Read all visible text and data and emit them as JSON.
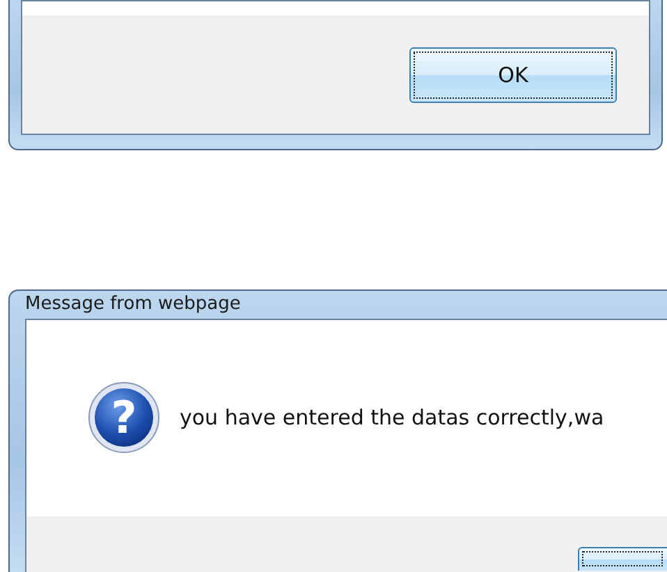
{
  "dialogs": [
    {
      "buttons": [
        {
          "label": "OK",
          "focused": true
        }
      ]
    },
    {
      "title": "Message from webpage",
      "message": "you have entered the datas correctly,wa",
      "icon_glyph": "?",
      "buttons": [
        {
          "focused": true
        }
      ]
    }
  ]
}
